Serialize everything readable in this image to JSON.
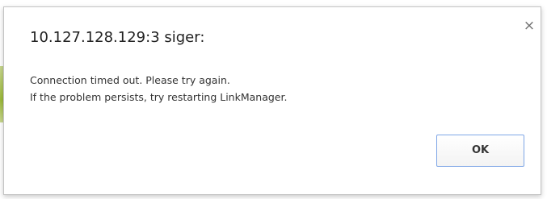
{
  "dialog": {
    "title": "10.127.128.129:3 siger:",
    "message_lines": [
      "Connection timed out. Please try again.",
      "If the problem persists, try restarting LinkManager."
    ],
    "ok_label": "OK",
    "close_glyph": "×"
  },
  "icons": {
    "close": "close-icon"
  },
  "colors": {
    "button_border": "#7ea6e6",
    "background_accent": "#9dbb3b"
  }
}
